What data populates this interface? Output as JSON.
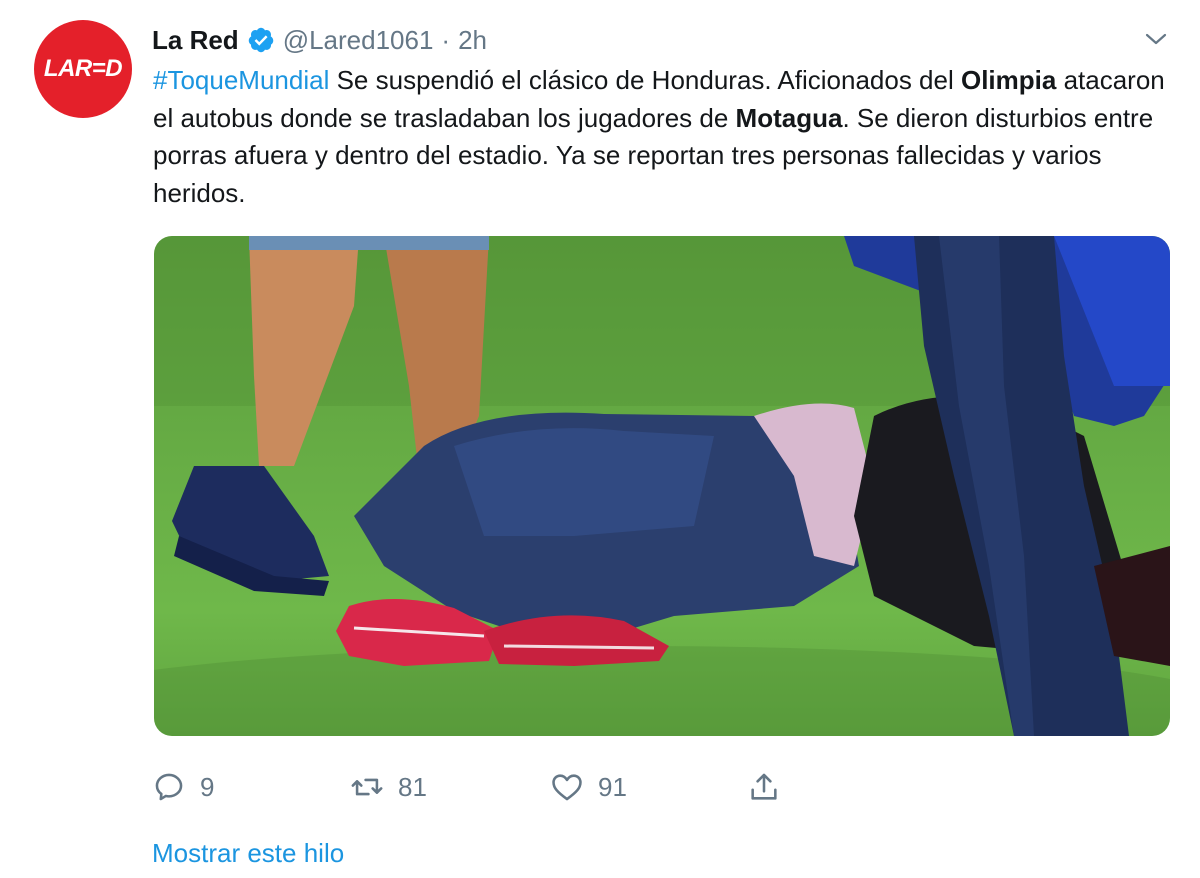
{
  "account": {
    "avatar_text": "LAR=D",
    "name": "La Red",
    "handle": "@Lared1061",
    "separator": "·",
    "time": "2h"
  },
  "tweet": {
    "hashtag": "#ToqueMundial",
    "text_1": " Se suspendió el clásico de Honduras. Aficionados del ",
    "bold_1": "Olimpia",
    "text_2": " atacaron el autobus donde se trasladaban los jugadores de ",
    "bold_2": "Motagua",
    "text_3": ". Se dieron disturbios entre porras afuera y dentro del estadio. Ya se reportan tres personas fallecidas y varios heridos."
  },
  "actions": {
    "replies": "9",
    "retweets": "81",
    "likes": "91"
  },
  "footer": {
    "show_thread": "Mostrar este hilo"
  },
  "colors": {
    "link": "#1b95e0",
    "muted": "#657786",
    "avatar_red": "#e4202a",
    "verified": "#1da1f2"
  },
  "icons": [
    "verified-badge-icon",
    "chevron-down-icon",
    "reply-icon",
    "retweet-icon",
    "like-icon",
    "share-icon"
  ]
}
